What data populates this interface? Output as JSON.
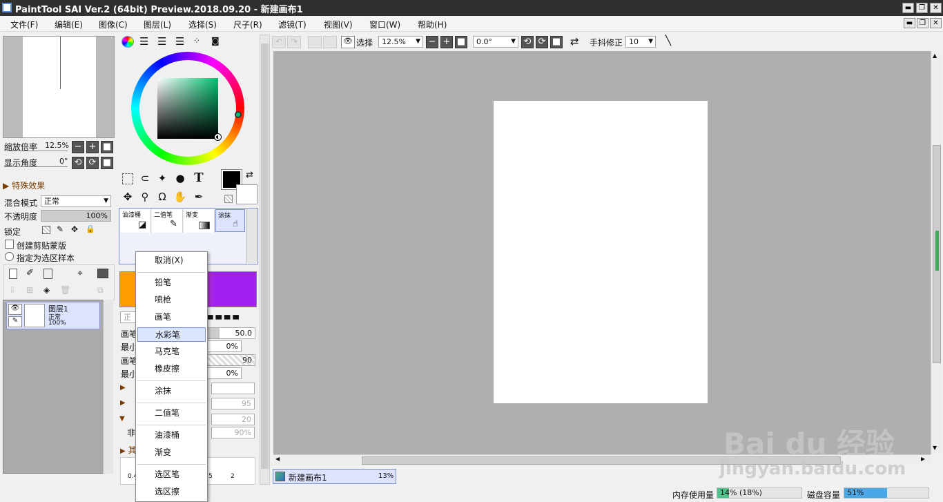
{
  "window": {
    "title": "PaintTool SAI Ver.2 (64bit) Preview.2018.09.20 - 新建画布1",
    "min": "▬",
    "restore": "❐",
    "close": "✕"
  },
  "menu": [
    "文件(F)",
    "编辑(E)",
    "图像(C)",
    "图层(L)",
    "选择(S)",
    "尺子(R)",
    "滤镜(T)",
    "视图(V)",
    "窗口(W)",
    "帮助(H)"
  ],
  "nav": {
    "zoom_label": "缩放倍率",
    "zoom_value": "12.5%",
    "angle_label": "显示角度",
    "angle_value": "0°",
    "minus": "−",
    "plus": "+",
    "reset": "■",
    "rot_l": "⟲",
    "rot_r": "⟳"
  },
  "effects": {
    "label": "特殊效果",
    "blend_label": "混合模式",
    "blend_value": "正常",
    "opacity_label": "不透明度",
    "opacity_value": "100%",
    "opacity_pct": 100,
    "lock_label": "锁定",
    "clip_label": "创建剪贴蒙版",
    "select_src_label": "指定为选区样本"
  },
  "layers": [
    {
      "name": "图层1",
      "mode": "正常",
      "opacity": "100%"
    }
  ],
  "tools": {
    "text_icon": "T"
  },
  "brushes": [
    {
      "name": "油漆桶"
    },
    {
      "name": "二值笔"
    },
    {
      "name": "渐变"
    },
    {
      "name": "涂抹"
    }
  ],
  "params": {
    "size_label": "画笔",
    "size_value": "50.0",
    "min_label": "最小",
    "min_value": "0%",
    "density_label": "画笔",
    "density_value": "90",
    "min2_label": "最小",
    "min2_value": "0%",
    "val95": "95",
    "val20": "20",
    "val90": "90%",
    "feibi": "非",
    "qita": "其",
    "dot1": "0.4",
    "dot2": "5",
    "dot3": "2",
    "normal_hint": "正"
  },
  "context_menu": {
    "cancel": "取消(X)",
    "pencil": "铅笔",
    "airbrush": "喷枪",
    "brush": "画笔",
    "watercolor": "水彩笔",
    "marker": "马克笔",
    "eraser": "橡皮擦",
    "smudge": "涂抹",
    "binary": "二值笔",
    "bucket": "油漆桶",
    "gradient": "渐变",
    "sel_pen": "选区笔",
    "sel_eraser": "选区擦"
  },
  "toolbar": {
    "select_label": "选择",
    "zoom_value": "12.5%",
    "angle_value": "0.0°",
    "stabilizer_label": "手抖修正",
    "stabilizer_value": "10"
  },
  "canvas": {
    "tab_name": "新建画布1",
    "tab_zoom": "13%"
  },
  "status": {
    "mem_label": "内存使用量",
    "mem_value": "14% (18%)",
    "mem_pct": 14,
    "disk_label": "磁盘容量",
    "disk_value": "51%",
    "disk_pct": 51
  },
  "watermark": {
    "brand": "Bai du 经验",
    "url": "jingyan.baidu.com"
  },
  "colors": {
    "fg": "#000000",
    "bg": "#ffffff",
    "primary": "#ff9d00",
    "secondary": "#a020f0"
  }
}
